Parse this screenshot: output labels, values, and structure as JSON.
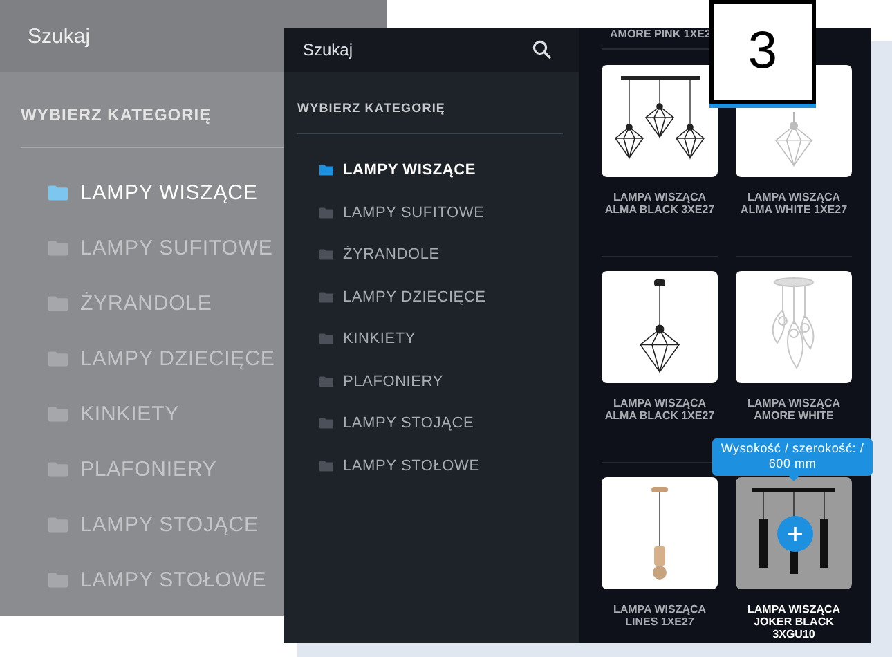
{
  "background_panel": {
    "search": {
      "placeholder": "Szukaj"
    },
    "heading": "WYBIERZ KATEGORIĘ",
    "categories": [
      {
        "label": "LAMPY WISZĄCE",
        "selected": true
      },
      {
        "label": "LAMPY SUFITOWE",
        "selected": false
      },
      {
        "label": "ŻYRANDOLE",
        "selected": false
      },
      {
        "label": "LAMPY DZIECIĘCE",
        "selected": false
      },
      {
        "label": "KINKIETY",
        "selected": false
      },
      {
        "label": "PLAFONIERY",
        "selected": false
      },
      {
        "label": "LAMPY STOJĄCE",
        "selected": false
      },
      {
        "label": "LAMPY STOŁOWE",
        "selected": false
      }
    ]
  },
  "front_panel": {
    "search": {
      "placeholder": "Szukaj"
    },
    "heading": "WYBIERZ KATEGORIĘ",
    "categories": [
      {
        "label": "LAMPY WISZĄCE",
        "selected": true
      },
      {
        "label": "LAMPY SUFITOWE",
        "selected": false
      },
      {
        "label": "ŻYRANDOLE",
        "selected": false
      },
      {
        "label": "LAMPY DZIECIĘCE",
        "selected": false
      },
      {
        "label": "KINKIETY",
        "selected": false
      },
      {
        "label": "PLAFONIERY",
        "selected": false
      },
      {
        "label": "LAMPY STOJĄCE",
        "selected": false
      },
      {
        "label": "LAMPY STOŁOWE",
        "selected": false
      }
    ],
    "cut_product_name": "AMORE PINK 1XE2",
    "products": [
      {
        "name": "LAMPA WISZĄCA ALMA BLACK 3XE27",
        "kind": "cage-triple",
        "highlighted": false
      },
      {
        "name": "LAMPA WISZĄCA ALMA WHITE 1XE27",
        "kind": "cage-white",
        "highlighted": false
      },
      {
        "name": "LAMPA WISZĄCA ALMA BLACK 1XE27",
        "kind": "cage-single",
        "highlighted": false
      },
      {
        "name": "LAMPA WISZĄCA AMORE WHITE",
        "kind": "leaf-cluster",
        "highlighted": false
      },
      {
        "name": "LAMPA WISZĄCA LINES 1XE27",
        "kind": "wood-pendant",
        "highlighted": false
      },
      {
        "name": "LAMPA WISZĄCA JOKER BLACK 3XGU10",
        "kind": "tube-triple",
        "highlighted": true
      }
    ],
    "size_tooltip": "Wysokość / szerokość: / 600 mm"
  },
  "step_badge": "3"
}
